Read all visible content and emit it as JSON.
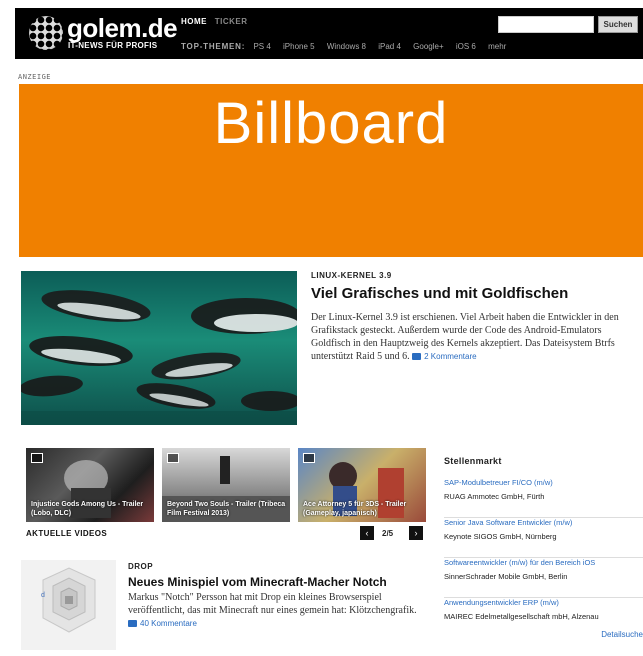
{
  "header": {
    "logo_text": "golem.de",
    "logo_tagline": "IT-NEWS FÜR PROFIS",
    "nav": [
      "HOME",
      "TICKER"
    ],
    "topics_label": "TOP-THEMEN:",
    "topics": [
      "PS 4",
      "iPhone 5",
      "Windows 8",
      "iPad 4",
      "Google+",
      "iOS 6",
      "mehr"
    ],
    "search_placeholder": "",
    "search_button": "Suchen"
  },
  "ad": {
    "label": "ANZEIGE",
    "billboard_text": "Billboard",
    "color": "#f08000"
  },
  "lead": {
    "kicker": "LINUX-KERNEL 3.9",
    "headline": "Viel Grafisches und mit Goldfischen",
    "teaser": "Der Linux-Kernel 3.9 ist erschienen. Viel Arbeit haben die Entwickler in den Grafikstack gesteckt. Außerdem wurde der Code des Android-Emulators Goldfisch in den Hauptzweig des Kernels akzeptiert. Das Dateisystem Btrfs unterstützt Raid 5 und 6.",
    "comments": "2 Kommentare"
  },
  "videos": {
    "label": "AKTUELLE VIDEOS",
    "items": [
      {
        "caption": "Injustice Gods Among Us - Trailer (Lobo, DLC)"
      },
      {
        "caption": "Beyond Two Souls - Trailer (Tribeca Film Festival 2013)"
      },
      {
        "caption": "Ace Attorney 5 für 3DS - Trailer (Gameplay, japanisch)"
      }
    ],
    "prev": "‹",
    "next": "›",
    "page": "2/5"
  },
  "jobs": {
    "title": "Stellenmarkt",
    "items": [
      {
        "title": "SAP-Modulbetreuer FI/CO (m/w)",
        "company": "RUAG Ammotec GmbH, Fürth"
      },
      {
        "title": "Senior Java Software Entwickler (m/w)",
        "company": "Keynote SIGOS GmbH, Nürnberg"
      },
      {
        "title": "Softwareentwickler (m/w) für den Bereich iOS",
        "company": "SinnerSchrader Mobile GmbH, Berlin"
      },
      {
        "title": "Anwendungsentwickler ERP (m/w)",
        "company": "MAIREC Edelmetallgesellschaft mbH, Alzenau"
      }
    ],
    "details": "Detailsuche"
  },
  "second": {
    "kicker": "DROP",
    "headline": "Neues Minispiel vom Minecraft-Macher Notch",
    "teaser": "Markus \"Notch\" Persson hat mit Drop ein kleines Browserspiel veröffentlicht, das mit Minecraft nur eines gemein hat: Klötzchengrafik.",
    "comments": "40 Kommentare",
    "thumb_letter": "d"
  },
  "colors": {
    "link": "#2a6cc0",
    "header_bg": "#000000",
    "billboard": "#f08000"
  }
}
